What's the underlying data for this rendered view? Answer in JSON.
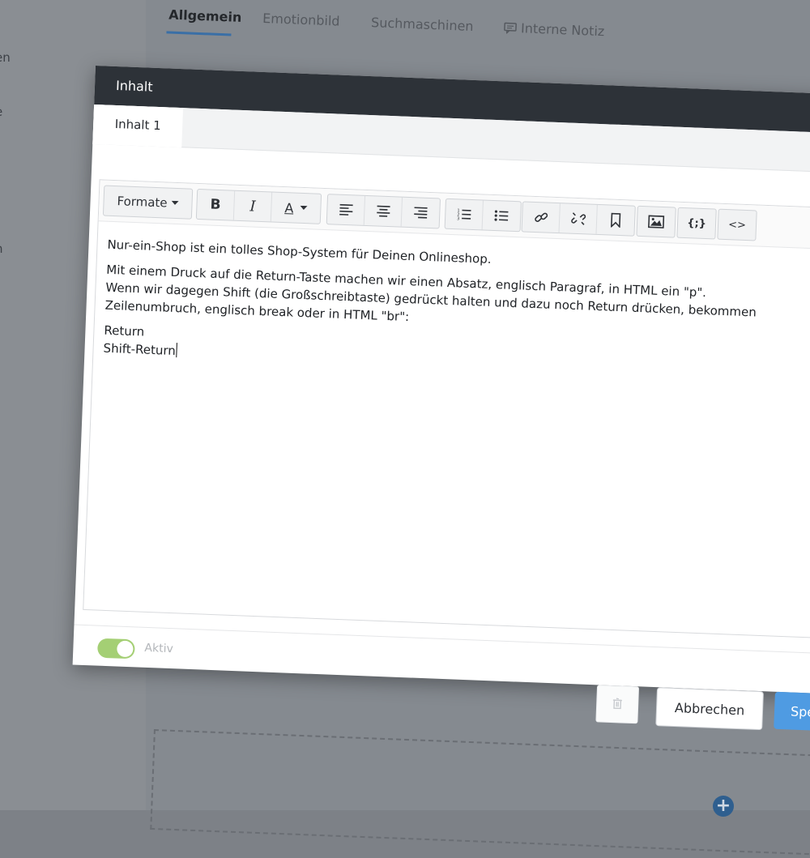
{
  "background": {
    "sidebar_items": [
      "en",
      "e",
      "n"
    ],
    "tabs": [
      {
        "label": "Allgemein",
        "active": true
      },
      {
        "label": "Emotionbild",
        "active": false
      },
      {
        "label": "Suchmaschinen",
        "active": false
      },
      {
        "label": "Interne Notiz",
        "active": false,
        "icon": "comment-icon"
      }
    ]
  },
  "modal": {
    "title": "Inhalt",
    "content_tab": "Inhalt 1",
    "toolbar": {
      "formats_label": "Formate",
      "bold_label": "B",
      "italic_label": "I",
      "text_color_label": "A",
      "source_code_label": "<>",
      "variables_label": "{;}"
    },
    "editor_lines": [
      "Nur-ein-Shop ist ein tolles Shop-System für Deinen Onlineshop.",
      "Mit einem Druck auf die Return-Taste machen wir einen Absatz, englisch Paragraf, in HTML ein \"p\".",
      "Wenn wir dagegen Shift (die Großschreibtaste) gedrückt halten und dazu noch Return drücken, bekommen",
      "Zeilenumbruch, englisch break oder in HTML \"br\":",
      "Return",
      "Shift-Return"
    ],
    "active_toggle": {
      "label": "Aktiv",
      "on": true
    },
    "cancel_label": "Abbrechen",
    "save_label": "Speic"
  },
  "colors": {
    "header_bg": "#2d3238",
    "toggle_on": "#a4cf74",
    "primary": "#4f9be2"
  }
}
